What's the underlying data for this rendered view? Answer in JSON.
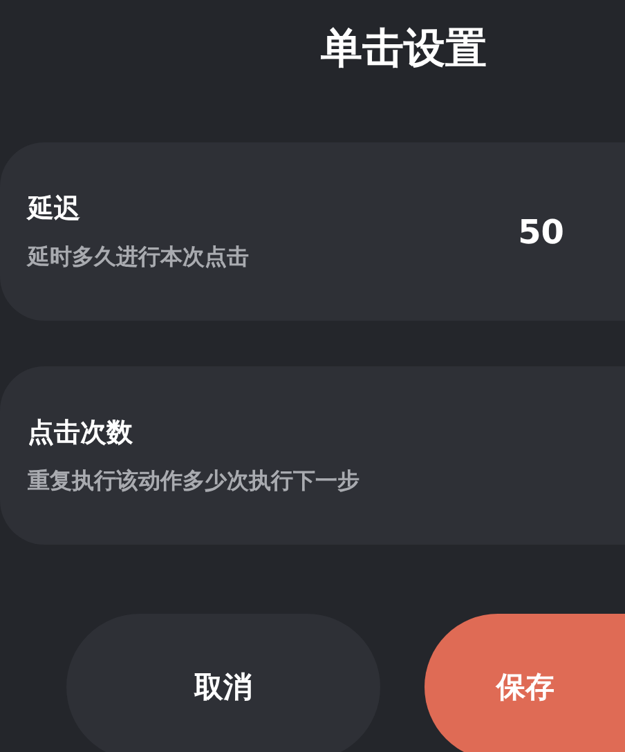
{
  "title": "单击设置",
  "settings": [
    {
      "label": "延迟",
      "description": "延时多久进行本次点击",
      "value": "50"
    },
    {
      "label": "点击次数",
      "description": "重复执行该动作多少次执行下一步"
    }
  ],
  "buttons": [
    {
      "label": "取消",
      "kind": "secondary"
    },
    {
      "label": "保存",
      "kind": "primary"
    }
  ]
}
